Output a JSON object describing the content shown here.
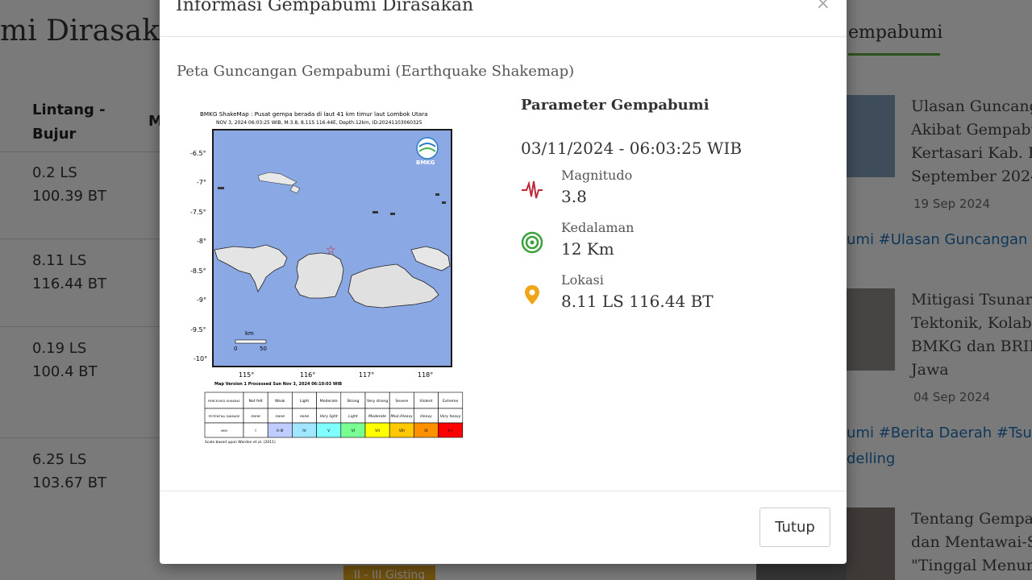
{
  "background": {
    "page_title": "mi Dirasak",
    "table_headers": [
      "Lintang -",
      "Bujur",
      "M"
    ],
    "rows": [
      {
        "lat": "0.2 LS",
        "lon": "100.39 BT"
      },
      {
        "lat": "8.11 LS",
        "lon": "116.44 BT"
      },
      {
        "lat": "0.19 LS",
        "lon": "100.4 BT"
      },
      {
        "lat": "6.25 LS",
        "lon": "103.67 BT"
      }
    ],
    "badge": "II - III Gisting",
    "sidebar_tab": "empabumi",
    "news": [
      {
        "lines": [
          "Ulasan Guncang",
          "Akibat Gempabu",
          "Kertasari Kab. B",
          "September 2024"
        ],
        "date": "19 Sep 2024",
        "tags": "umi #Ulasan Guncangan T"
      },
      {
        "lines": [
          "Mitigasi Tsunar",
          "Tektonik, Kolabo",
          "BMKG dan BRIN",
          "Jawa"
        ],
        "date": "04 Sep 2024",
        "tags": "umi #Berita Daerah #Tsun",
        "tags2": "delling"
      },
      {
        "lines": [
          "Tentang Gempa",
          "dan Mentawai-S",
          "\"Tinggal Menum"
        ]
      }
    ]
  },
  "modal": {
    "title": "Informasi Gempabumi Dirasakan",
    "close_symbol": "×",
    "subtitle": "Peta Guncangan Gempabumi (Earthquake Shakemap)",
    "shakemap": {
      "title_line1": "BMKG ShakeMap : Pusat gempa berada di laut 41 km timur laut Lombok Utara",
      "title_line2": "NOV 3, 2024 06:03:25 WIB, M:3.8, 8.11S 116.44E, Depth:12km, ID:20241103060325",
      "logo_text": "BMKG",
      "y_ticks": [
        "-6.5°",
        "-7°",
        "-7.5°",
        "-8°",
        "-8.5°",
        "-9°",
        "-9.5°",
        "-10°"
      ],
      "x_ticks": [
        "115°",
        "116°",
        "117°",
        "118°"
      ],
      "scale_label": "km",
      "scale_ticks": [
        "0",
        "50"
      ],
      "version_note": "Map Version 1 Processed Sun Nov 3, 2024 06:10:03 WIB",
      "legend_rows": [
        [
          "PERCEIVED SHAKING",
          "Not felt",
          "Weak",
          "Light",
          "Moderate",
          "Strong",
          "Very strong",
          "Severe",
          "Violent",
          "Extreme"
        ],
        [
          "POTENTIAL DAMAGE",
          "none",
          "none",
          "none",
          "Very light",
          "Light",
          "Moderate",
          "Mod./Heavy",
          "Heavy",
          "Very heavy"
        ],
        [
          "MMI",
          "I",
          "II-III",
          "IV",
          "V",
          "VI",
          "VII",
          "VIII",
          "IX",
          "X+"
        ]
      ],
      "mmi_colors": [
        "#ffffff",
        "#bfccff",
        "#a0e6ff",
        "#80ffff",
        "#7aff93",
        "#ffff00",
        "#ffc800",
        "#ff9100",
        "#ff0000",
        "#c80000"
      ],
      "footnote": "Scale based upon Worden et al. (2011)"
    },
    "params": {
      "heading": "Parameter Gempabumi",
      "datetime": "03/11/2024 - 06:03:25 WIB",
      "items": [
        {
          "label": "Magnitudo",
          "value": "3.8",
          "icon": "seismograph-icon",
          "color": "#c0283a"
        },
        {
          "label": "Kedalaman",
          "value": "12 Km",
          "icon": "depth-rings-icon",
          "color": "#3aa13a"
        },
        {
          "label": "Lokasi",
          "value": "8.11 LS 116.44 BT",
          "icon": "location-pin-icon",
          "color": "#f0a418"
        }
      ]
    },
    "close_button": "Tutup"
  }
}
